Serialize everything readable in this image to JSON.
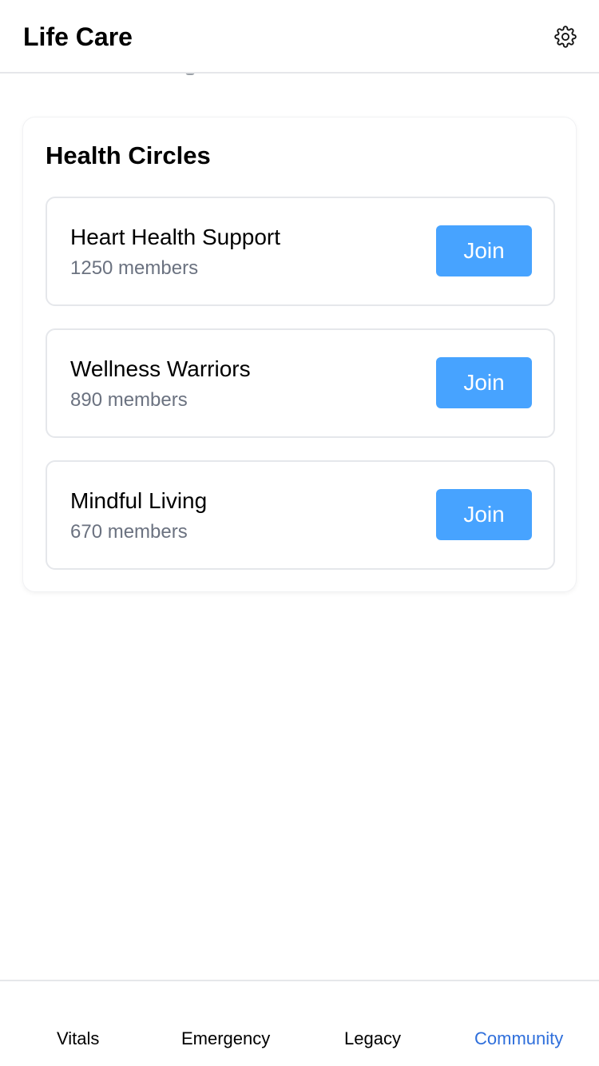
{
  "header": {
    "title": "Life Care"
  },
  "icons": {
    "settings": "gear-icon"
  },
  "health_circles": {
    "title": "Health Circles",
    "circles": [
      {
        "name": "Heart Health Support",
        "members": "1250 members",
        "action": "Join"
      },
      {
        "name": "Wellness Warriors",
        "members": "890 members",
        "action": "Join"
      },
      {
        "name": "Mindful Living",
        "members": "670 members",
        "action": "Join"
      }
    ]
  },
  "tabs": [
    {
      "label": "Vitals"
    },
    {
      "label": "Emergency"
    },
    {
      "label": "Legacy"
    },
    {
      "label": "Community"
    }
  ],
  "active_tab": "Community",
  "colors": {
    "accent": "#47a3ff",
    "active_tab": "#2f6fdb",
    "muted_text": "#6b7280",
    "border": "#e5e7eb"
  }
}
